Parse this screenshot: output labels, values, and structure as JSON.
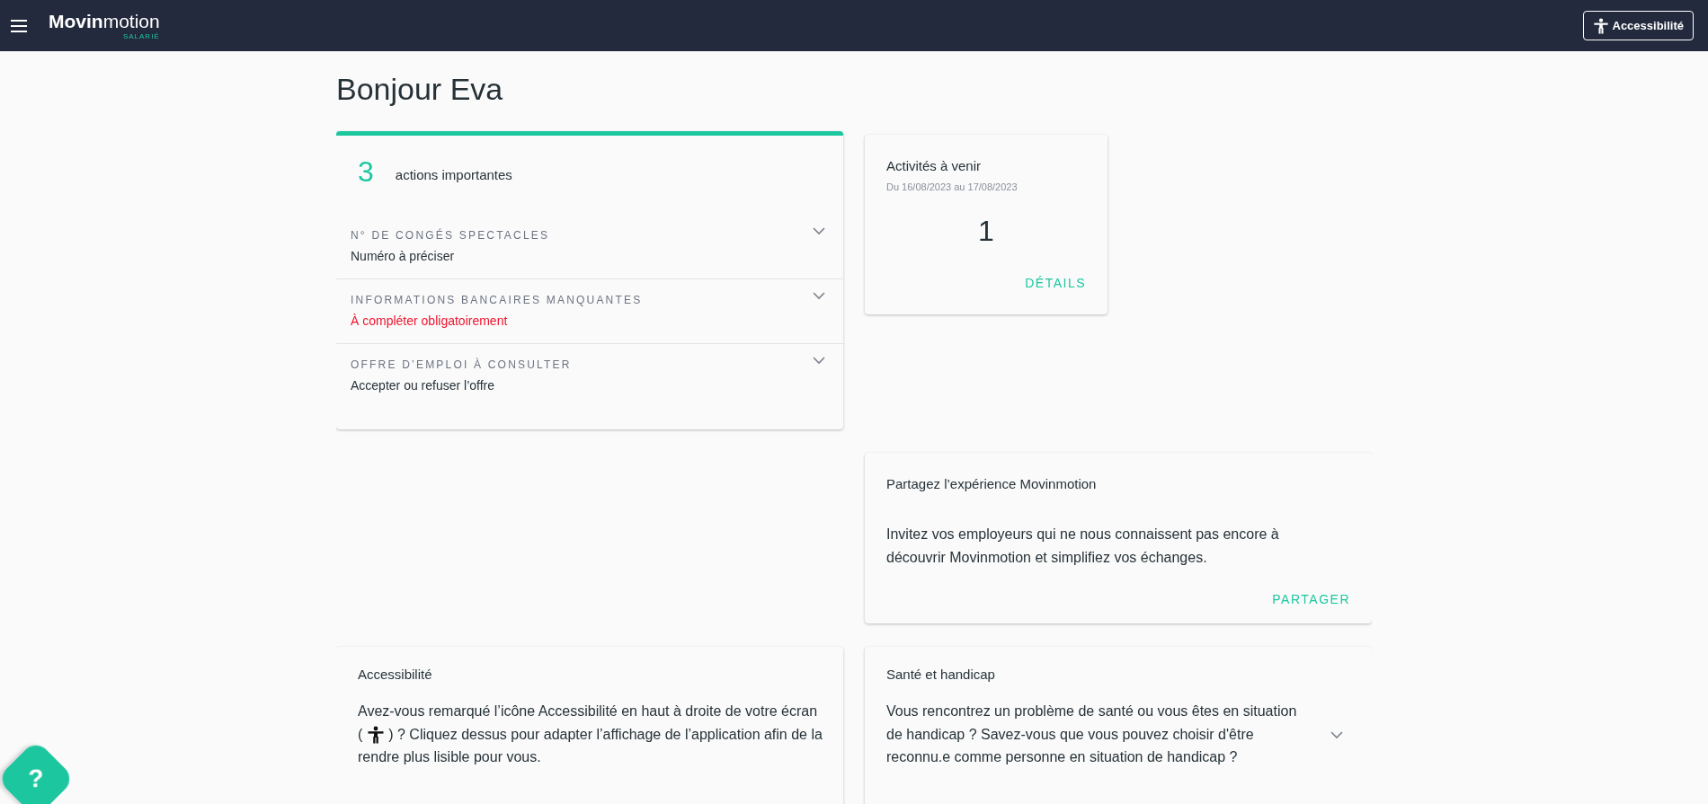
{
  "header": {
    "logo": {
      "bold": "Movin",
      "light": "motion",
      "subtitle": "SALARIÉ"
    },
    "accessibility_button": "Accessibilité"
  },
  "greeting": "Bonjour Eva",
  "actions": {
    "count": "3",
    "label": "actions importantes",
    "items": [
      {
        "title": "N° DE CONGÉS SPECTACLES",
        "subtitle": "Numéro à préciser",
        "urgent": false,
        "expanded": false
      },
      {
        "title": "INFORMATIONS BANCAIRES MANQUANTES",
        "subtitle": "À compléter obligatoirement",
        "urgent": true,
        "expanded": false
      },
      {
        "title": "OFFRE D’EMPLOI À CONSULTER",
        "subtitle": "Accepter ou refuser l’offre",
        "urgent": false,
        "expanded": false
      }
    ]
  },
  "activities": {
    "title": "Activités à venir",
    "period": "Du 16/08/2023 au 17/08/2023",
    "count": "1",
    "link": "DÉTAILS"
  },
  "share": {
    "title": "Partagez l’expérience Movinmotion",
    "text": "Invitez vos employeurs qui ne nous connaissent pas encore à découvrir Movinmotion et simplifiez vos échanges.",
    "link": "PARTAGER"
  },
  "accessibility": {
    "title": "Accessibilité",
    "text_before": "Avez-vous remarqué l’icône Accessibilité en haut à droite de votre écran (",
    "text_after": ") ? Cliquez dessus pour adapter l’affichage de l’application afin de la rendre plus lisible pour vous."
  },
  "health": {
    "title": "Santé et handicap",
    "text": "Vous rencontrez un problème de santé ou vous êtes en situation de handicap ? Savez-vous que vous pouvez choisir d'être reconnu.e comme personne en situation de handicap ?",
    "expanded": false
  },
  "help_button": "?"
}
